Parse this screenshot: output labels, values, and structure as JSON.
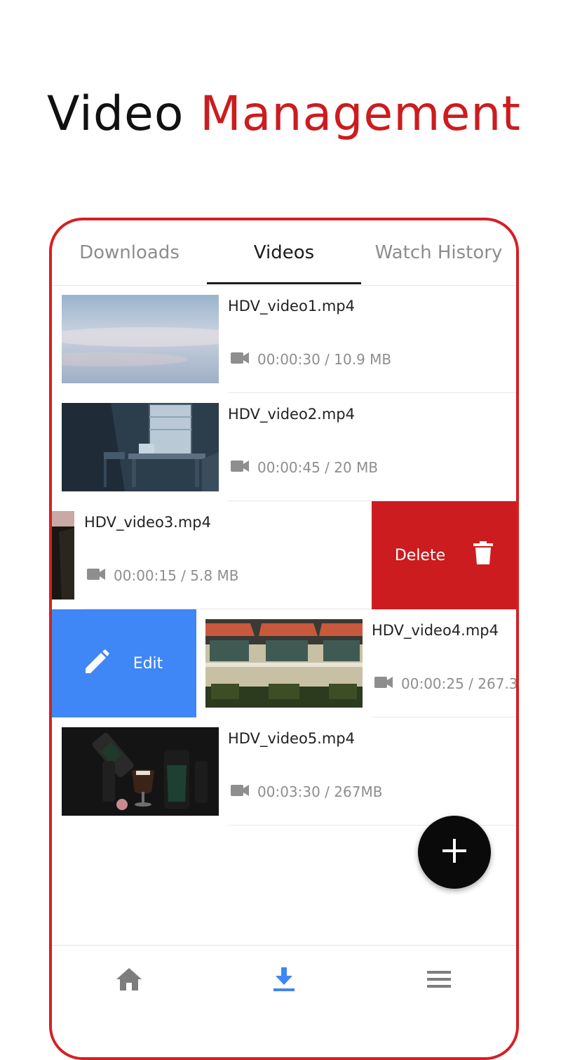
{
  "headline": {
    "word1": "Video",
    "word2": "Management"
  },
  "tabs": [
    {
      "label": "Downloads"
    },
    {
      "label": "Videos"
    },
    {
      "label": "Watch History"
    }
  ],
  "videos": [
    {
      "name": "HDV_video1.mp4",
      "meta": "00:00:30 / 10.9 MB"
    },
    {
      "name": "HDV_video2.mp4",
      "meta": "00:00:45 / 20 MB"
    },
    {
      "name": "HDV_video3.mp4",
      "meta": "00:00:15 / 5.8 MB"
    },
    {
      "name": "HDV_video4.mp4",
      "meta": "00:00:25 / 267.3"
    },
    {
      "name": "HDV_video5.mp4",
      "meta": "00:03:30 / 267MB"
    }
  ],
  "swipe_actions": {
    "delete_label": "Delete",
    "edit_label": "Edit"
  },
  "colors": {
    "accent": "#cc1c1f",
    "edit": "#3f86f6",
    "active_nav": "#3f86f6"
  },
  "icons": {
    "meta": "videocam-icon",
    "delete": "trash-icon",
    "edit": "pencil-icon",
    "fab": "plus-icon",
    "nav": [
      "home-icon",
      "download-icon",
      "menu-icon"
    ]
  }
}
